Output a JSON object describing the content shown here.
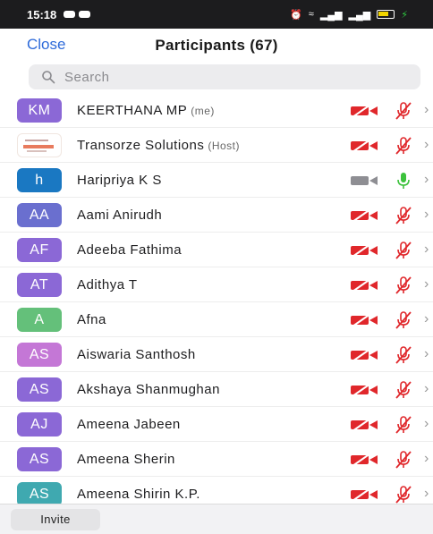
{
  "status_bar": {
    "time": "15:18"
  },
  "header": {
    "close_label": "Close",
    "title": "Participants (67)"
  },
  "search": {
    "placeholder": "Search"
  },
  "participants": [
    {
      "initials": "KM",
      "name": "KEERTHANA MP",
      "role": "(me)",
      "avatar_color": "#8b68d6",
      "video": "off",
      "audio": "muted"
    },
    {
      "initials": "",
      "name": "Transorze Solutions",
      "role": "(Host)",
      "avatar_color": "#ffffff",
      "avatar_type": "logo",
      "video": "off",
      "audio": "muted"
    },
    {
      "initials": "h",
      "name": "Haripriya K S",
      "role": "",
      "avatar_color": "#1a78c2",
      "video": "on",
      "audio": "on"
    },
    {
      "initials": "AA",
      "name": "Aami Anirudh",
      "role": "",
      "avatar_color": "#6a6fcf",
      "video": "off",
      "audio": "muted"
    },
    {
      "initials": "AF",
      "name": "Adeeba Fathima",
      "role": "",
      "avatar_color": "#8b68d6",
      "video": "off",
      "audio": "muted"
    },
    {
      "initials": "AT",
      "name": "Adithya T",
      "role": "",
      "avatar_color": "#8b68d6",
      "video": "off",
      "audio": "muted"
    },
    {
      "initials": "A",
      "name": "Afna",
      "role": "",
      "avatar_color": "#64c07a",
      "video": "off",
      "audio": "muted"
    },
    {
      "initials": "AS",
      "name": "Aiswaria Santhosh",
      "role": "",
      "avatar_color": "#c477d6",
      "video": "off",
      "audio": "muted"
    },
    {
      "initials": "AS",
      "name": "Akshaya Shanmughan",
      "role": "",
      "avatar_color": "#8b68d6",
      "video": "off",
      "audio": "muted"
    },
    {
      "initials": "AJ",
      "name": "Ameena Jabeen",
      "role": "",
      "avatar_color": "#8b68d6",
      "video": "off",
      "audio": "muted"
    },
    {
      "initials": "AS",
      "name": "Ameena Sherin",
      "role": "",
      "avatar_color": "#8b68d6",
      "video": "off",
      "audio": "muted"
    },
    {
      "initials": "AS",
      "name": "Ameena Shirin K.P.",
      "role": "",
      "avatar_color": "#3fa9b0",
      "video": "off",
      "audio": "muted"
    }
  ],
  "footer": {
    "invite_label": "Invite"
  },
  "colors": {
    "accent": "#2d6ad9",
    "muted_red": "#e0272b",
    "unmuted_green": "#3cc23c",
    "video_on_gray": "#8e8e93"
  }
}
